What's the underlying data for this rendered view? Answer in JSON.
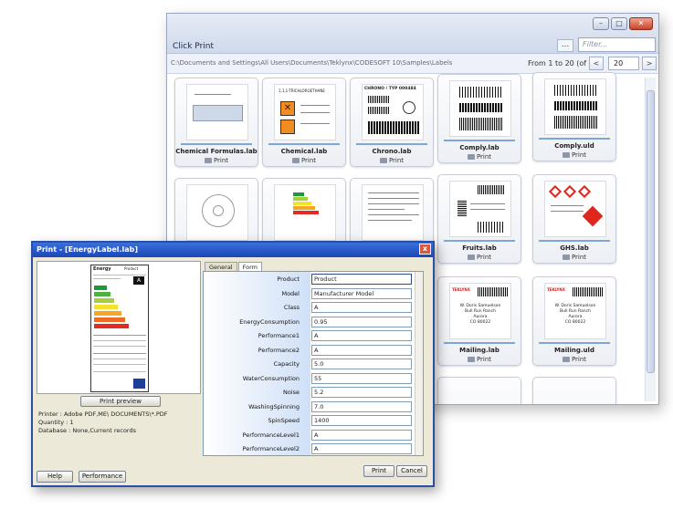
{
  "main_window": {
    "title": "Click Print",
    "more_button": "...",
    "filter_placeholder": "Filter...",
    "path": "C:\\Documents and Settings\\All Users\\Documents\\Teklynx\\CODESOFT 10\\Samples\\Labels",
    "pagination_text": "From 1 to 20 (of 24)",
    "page_size": "20",
    "prev_label": "<",
    "next_label": ">"
  },
  "labels": [
    {
      "name": "Chemical Formulas.lab",
      "print": "Print"
    },
    {
      "name": "Chemical.lab",
      "print": "Print"
    },
    {
      "name": "Chrono.lab",
      "print": "Print"
    },
    {
      "name": "Comply.lab",
      "print": "Print"
    },
    {
      "name": "Comply.uld",
      "print": "Print"
    },
    {
      "name": "",
      "print": ""
    },
    {
      "name": "",
      "print": ""
    },
    {
      "name": "",
      "print": ""
    },
    {
      "name": "Fruits.lab",
      "print": "Print"
    },
    {
      "name": "GHS.lab",
      "print": "Print"
    },
    {
      "name": "Mailing.lab",
      "print": "Print"
    },
    {
      "name": "Mailing.uld",
      "print": "Print"
    }
  ],
  "thumb_text": {
    "chrono_title": "CHRONO / TYP 000484",
    "mail_name": "W. Doris Samuelson",
    "mail_street": "Bull Run Ranch",
    "mail_city": "Aurora",
    "mail_zip": "CO 80022",
    "chem_title": "1,1,1-TRICHLOROETHANE",
    "brand": "TEKLYNX"
  },
  "dialog": {
    "title": "Print - [EnergyLabel.lab]",
    "close": "x",
    "preview_button": "Print preview",
    "printer": "Printer : Adobe PDF,ME\\ DOCUMENTS\\*.PDF",
    "quantity": "Quantity : 1",
    "database": "Database : None,Current records",
    "tabs": [
      "General",
      "Form"
    ],
    "help": "Help",
    "performance": "Performance",
    "print": "Print",
    "cancel": "Cancel",
    "fields": [
      {
        "label": "Product",
        "value": "Product"
      },
      {
        "label": "Model",
        "value": "Manufacturer Model"
      },
      {
        "label": "Class",
        "value": "A"
      },
      {
        "label": "EnergyConsumption",
        "value": "0.95"
      },
      {
        "label": "Performance1",
        "value": "A"
      },
      {
        "label": "Performance2",
        "value": "A"
      },
      {
        "label": "Capacity",
        "value": "5.0"
      },
      {
        "label": "WaterConsumption",
        "value": "55"
      },
      {
        "label": "Noise",
        "value": "5.2"
      },
      {
        "label": "WashingSpinning",
        "value": "7.0"
      },
      {
        "label": "SpinSpeed",
        "value": "1400"
      },
      {
        "label": "PerformanceLevel1",
        "value": "A"
      },
      {
        "label": "PerformanceLevel2",
        "value": "A"
      }
    ]
  },
  "energy_label": {
    "title": "Energy",
    "product": "Product",
    "class": "A",
    "colors": [
      "#1a9a3c",
      "#52b043",
      "#a8cf3a",
      "#f4e12a",
      "#f6a623",
      "#ee6b26",
      "#e32b25"
    ]
  },
  "colors": {
    "accent_blue": "#2a4fa3",
    "ghs_red": "#e0251b"
  }
}
